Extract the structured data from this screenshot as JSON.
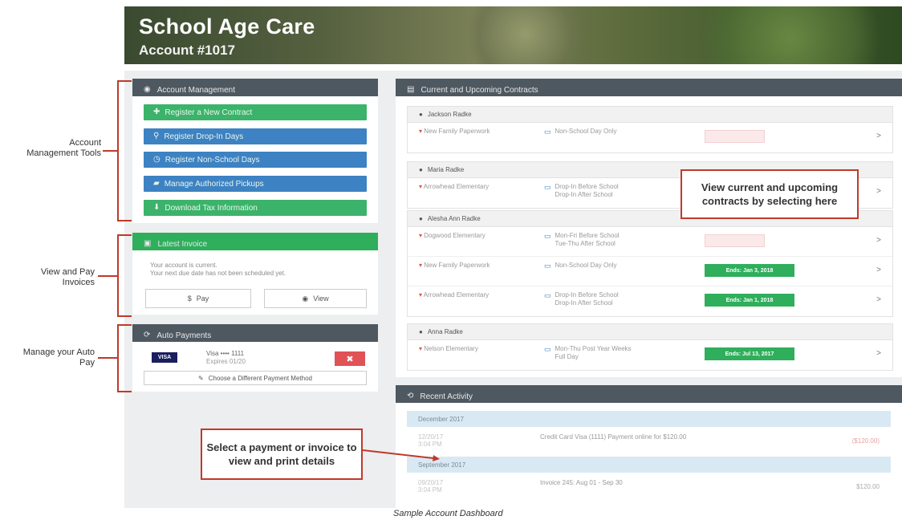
{
  "banner": {
    "title": "School Age Care",
    "account": "Account #1017"
  },
  "left": {
    "account_mgmt": {
      "title": "Account Management",
      "buttons": [
        {
          "label": "Register a New Contract",
          "color": "green"
        },
        {
          "label": "Register Drop-In Days",
          "color": "blue"
        },
        {
          "label": "Register Non-School Days",
          "color": "blue"
        },
        {
          "label": "Manage Authorized Pickups",
          "color": "blue"
        },
        {
          "label": "Download Tax Information",
          "color": "green"
        }
      ]
    },
    "invoice": {
      "title": "Latest Invoice",
      "line1": "Your account is current.",
      "line2": "Your next due date has not been scheduled yet.",
      "pay_label": "Pay",
      "view_label": "View"
    },
    "auto": {
      "title": "Auto Payments",
      "card_brand": "VISA",
      "card_number": "Visa •••• 1111",
      "card_expiry": "Expires 01/20",
      "choose_label": "Choose a Different Payment Method"
    }
  },
  "contracts": {
    "title": "Current and Upcoming Contracts",
    "groups": [
      {
        "name": "Jackson Radke",
        "rows": [
          {
            "loc": "New Family Paperwork",
            "sched1": "Non-School Day Only",
            "sched2": "",
            "status": "pending",
            "status_text": ""
          }
        ]
      },
      {
        "name": "Maria Radke",
        "rows": [
          {
            "loc": "Arrowhead Elementary",
            "sched1": "Drop-In Before School",
            "sched2": "Drop-In After School",
            "status": "none",
            "status_text": ""
          }
        ]
      },
      {
        "name": "Alesha Ann Radke",
        "rows": [
          {
            "loc": "Dogwood Elementary",
            "sched1": "Mon-Fri Before School",
            "sched2": "Tue-Thu After School",
            "status": "pending",
            "status_text": ""
          },
          {
            "loc": "New Family Paperwork",
            "sched1": "Non-School Day Only",
            "sched2": "",
            "status": "ends",
            "status_text": "Ends: Jan 3, 2018"
          },
          {
            "loc": "Arrowhead Elementary",
            "sched1": "Drop-In Before School",
            "sched2": "Drop-In After School",
            "status": "ends",
            "status_text": "Ends: Jan 1, 2018"
          }
        ]
      },
      {
        "name": "Anna Radke",
        "rows": [
          {
            "loc": "Nelson Elementary",
            "sched1": "Mon-Thu Post Year Weeks",
            "sched2": "Full Day",
            "status": "ends",
            "status_text": "Ends: Jul 13, 2017"
          }
        ]
      }
    ]
  },
  "activity": {
    "title": "Recent Activity",
    "months": [
      {
        "label": "December 2017",
        "entries": [
          {
            "date1": "12/20/17",
            "date2": "3:04 PM",
            "desc": "Credit Card Visa (1111) Payment online for $120.00",
            "amount": "($120.00)"
          }
        ]
      },
      {
        "label": "September 2017",
        "entries": [
          {
            "date1": "09/20/17",
            "date2": "3:04 PM",
            "desc": "Invoice 245: Aug 01 - Sep 30",
            "amount": "$120.00"
          }
        ]
      }
    ]
  },
  "annotations": {
    "account_tools": "Account Management Tools",
    "view_pay": "View and Pay Invoices",
    "manage_auto": "Manage your Auto Pay",
    "contracts_callout": "View current and upcoming contracts by selecting here",
    "payment_callout": "Select a payment or invoice to view and print details",
    "caption": "Sample Account Dashboard"
  },
  "colors": {
    "red_annotation": "#c0392b",
    "green": "#3bb36a",
    "blue": "#3d82c2",
    "header_dark": "#4e5860"
  }
}
